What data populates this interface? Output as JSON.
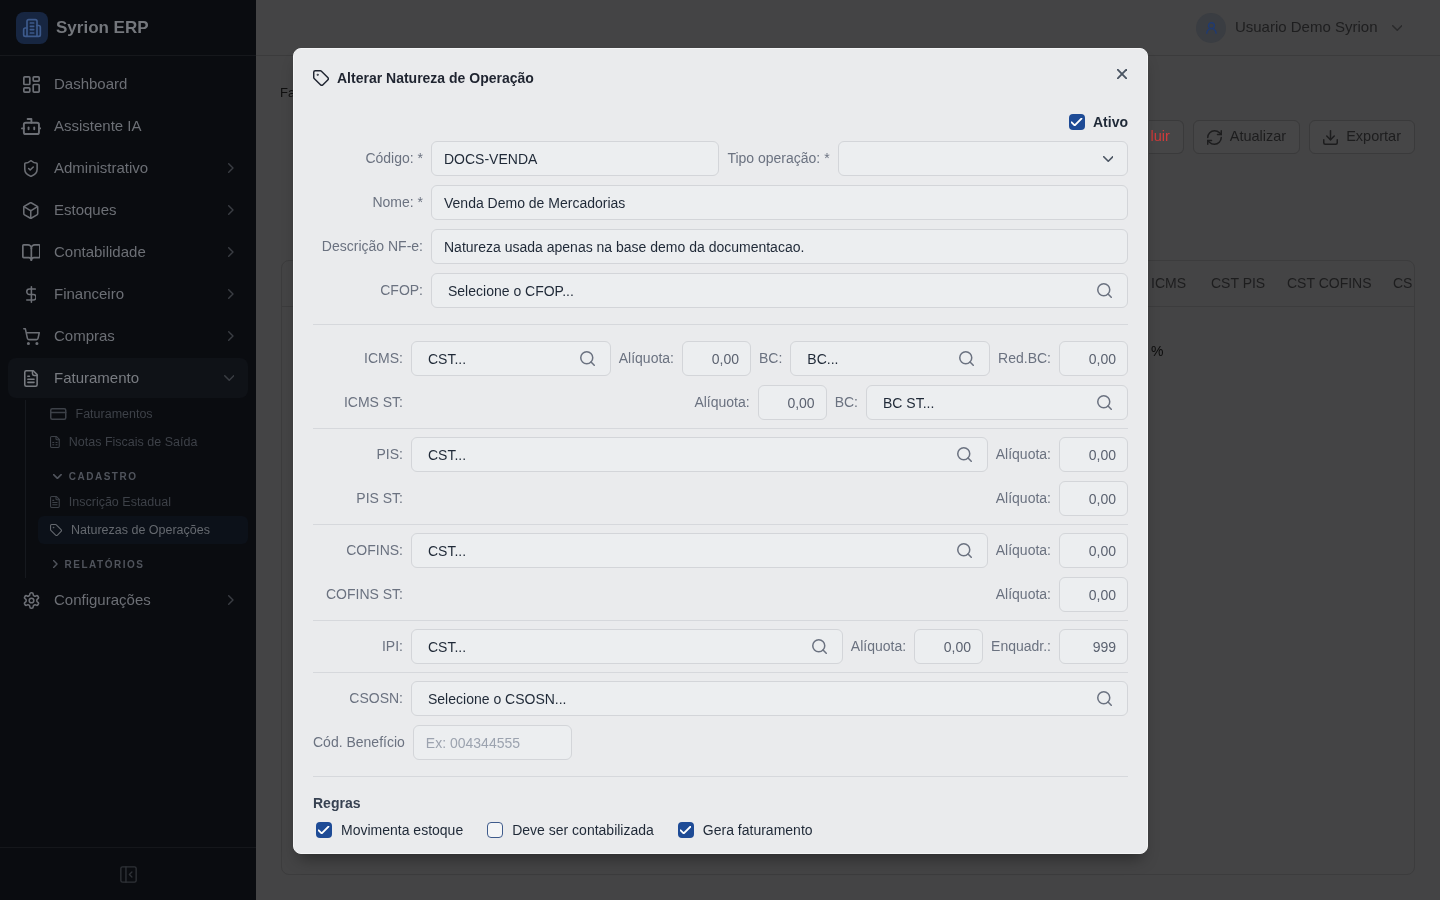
{
  "sidebar": {
    "brand": "Syrion ERP",
    "items": [
      {
        "kind": "link",
        "label": "Dashboard",
        "selected": false
      },
      {
        "kind": "link",
        "label": "Assistente IA",
        "selected": false
      },
      {
        "kind": "group",
        "label": "Administrativo",
        "selected": false,
        "expanded": false
      },
      {
        "kind": "group",
        "label": "Estoques",
        "selected": false,
        "expanded": false
      },
      {
        "kind": "group",
        "label": "Contabilidade",
        "selected": false,
        "expanded": false
      },
      {
        "kind": "group",
        "label": "Financeiro",
        "selected": false,
        "expanded": false
      },
      {
        "kind": "group",
        "label": "Compras",
        "selected": false,
        "expanded": false
      },
      {
        "kind": "group",
        "label": "Faturamento",
        "selected": true,
        "expanded": true,
        "children": [
          {
            "kind": "link",
            "label": "Faturamentos",
            "selected": false
          },
          {
            "kind": "link",
            "label": "Notas Fiscais de Saída",
            "selected": false
          },
          {
            "kind": "section",
            "label": "CADASTRO",
            "expanded": true,
            "children": [
              {
                "kind": "link",
                "label": "Inscrição Estadual",
                "selected": false
              },
              {
                "kind": "link",
                "label": "Naturezas de Operações",
                "selected": true
              }
            ]
          },
          {
            "kind": "section",
            "label": "RELATÓRIOS",
            "expanded": false
          }
        ]
      },
      {
        "kind": "group",
        "label": "Configurações",
        "selected": false,
        "expanded": false
      }
    ]
  },
  "header": {
    "user": {
      "name": "Usuario Demo Syrion"
    }
  },
  "page": {
    "breadcrumb": "Fa",
    "actions": [
      {
        "kind": "danger",
        "label": "luir"
      },
      {
        "kind": "refresh",
        "label": "Atualizar"
      },
      {
        "kind": "export",
        "label": "Exportar"
      }
    ]
  },
  "table": {
    "columns": [
      "ICMS",
      "CST PIS",
      "CST COFINS",
      "CS"
    ],
    "rows": [
      [
        "%"
      ]
    ]
  },
  "dialog": {
    "title": "Alterar Natureza de Operação",
    "active": {
      "label": "Ativo",
      "checked": true
    },
    "sections": [
      {
        "rows": [
          {
            "label": "Código: *",
            "items": [
              {
                "kind": "text",
                "value": "DOCS-VENDA"
              },
              {
                "kind": "label",
                "text": "Tipo operação: *"
              },
              {
                "kind": "select"
              }
            ]
          },
          {
            "label": "Nome: *",
            "items": [
              {
                "kind": "text",
                "value": "Venda Demo de Mercadorias"
              }
            ]
          },
          {
            "label": "Descrição NF-e:",
            "items": [
              {
                "kind": "text",
                "value": "Natureza usada apenas na base demo da documentacao."
              }
            ]
          },
          {
            "label": "CFOP:",
            "items": [
              {
                "kind": "lookup",
                "placeholder": "Selecione o CFOP..."
              }
            ]
          }
        ]
      },
      {
        "rows": [
          {
            "label": "ICMS:",
            "items": [
              {
                "kind": "lookup",
                "placeholder": "CST..."
              },
              {
                "kind": "label",
                "text": "Alíquota:"
              },
              {
                "kind": "number",
                "value": "0,00"
              },
              {
                "kind": "label",
                "text": "BC:"
              },
              {
                "kind": "lookup",
                "placeholder": "BC..."
              },
              {
                "kind": "label",
                "text": "Red.BC:"
              },
              {
                "kind": "number",
                "value": "0,00"
              }
            ]
          },
          {
            "label": "ICMS ST:",
            "items": [
              {
                "kind": "label",
                "text": "Alíquota:"
              },
              {
                "kind": "number",
                "value": "0,00"
              },
              {
                "kind": "label",
                "text": "BC:"
              },
              {
                "kind": "lookup",
                "placeholder": "BC ST..."
              }
            ]
          }
        ]
      },
      {
        "rows": [
          {
            "label": "PIS:",
            "items": [
              {
                "kind": "lookup",
                "placeholder": "CST..."
              },
              {
                "kind": "label",
                "text": "Alíquota:"
              },
              {
                "kind": "number",
                "value": "0,00"
              }
            ]
          },
          {
            "label": "PIS ST:",
            "items": [
              {
                "kind": "label",
                "text": "Alíquota:"
              },
              {
                "kind": "number",
                "value": "0,00"
              }
            ]
          }
        ]
      },
      {
        "rows": [
          {
            "label": "COFINS:",
            "items": [
              {
                "kind": "lookup",
                "placeholder": "CST..."
              },
              {
                "kind": "label",
                "text": "Alíquota:"
              },
              {
                "kind": "number",
                "value": "0,00"
              }
            ]
          },
          {
            "label": "COFINS ST:",
            "items": [
              {
                "kind": "label",
                "text": "Alíquota:"
              },
              {
                "kind": "number",
                "value": "0,00"
              }
            ]
          }
        ]
      },
      {
        "rows": [
          {
            "label": "IPI:",
            "items": [
              {
                "kind": "lookup",
                "placeholder": "CST..."
              },
              {
                "kind": "label",
                "text": "Alíquota:"
              },
              {
                "kind": "number",
                "value": "0,00"
              },
              {
                "kind": "label",
                "text": "Enquadr.:"
              },
              {
                "kind": "number",
                "value": "999"
              }
            ]
          }
        ]
      },
      {
        "rows": [
          {
            "label": "CSOSN:",
            "items": [
              {
                "kind": "lookup",
                "placeholder": "Selecione o CSOSN..."
              }
            ]
          },
          {
            "label": "Cód. Benefício",
            "items": [
              {
                "kind": "text",
                "placeholder": "Ex: 004344555"
              }
            ]
          }
        ]
      }
    ],
    "rules": {
      "title": "Regras",
      "options": [
        {
          "label": "Movimenta estoque",
          "checked": true
        },
        {
          "label": "Deve ser contabilizada",
          "checked": false
        },
        {
          "label": "Gera faturamento",
          "checked": true
        }
      ]
    }
  }
}
